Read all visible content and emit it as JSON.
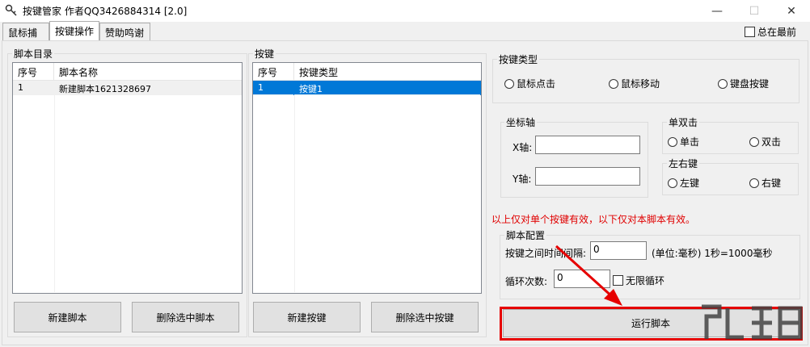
{
  "window": {
    "title": "按键管家 作者QQ3426884314  [2.0]",
    "minimize_glyph": "—",
    "maximize_glyph": "☐",
    "close_glyph": "✕"
  },
  "tabs": [
    "鼠标捕捉",
    "按键操作",
    "赞助鸣谢"
  ],
  "always_on_top_label": "总在最前",
  "script_list": {
    "group_title": "脚本目录",
    "columns": [
      "序号",
      "脚本名称"
    ],
    "rows": [
      [
        "1",
        "新建脚本1621328697"
      ]
    ],
    "new_button": "新建脚本",
    "delete_button": "删除选中脚本"
  },
  "key_list": {
    "group_title": "按键",
    "columns": [
      "序号",
      "按键类型"
    ],
    "rows": [
      [
        "1",
        "按键1"
      ]
    ],
    "new_button": "新建按键",
    "delete_button": "删除选中按键"
  },
  "key_type": {
    "group_title": "按键类型",
    "options": [
      "鼠标点击",
      "鼠标移动",
      "键盘按键"
    ]
  },
  "coords": {
    "group_title": "坐标轴",
    "x_label": "X轴:",
    "y_label": "Y轴:",
    "x_value": "",
    "y_value": ""
  },
  "click_type": {
    "group_title": "单双击",
    "options": [
      "单击",
      "双击"
    ]
  },
  "mouse_button": {
    "group_title": "左右键",
    "options": [
      "左键",
      "右键"
    ]
  },
  "notice": "以上仅对单个按键有效，以下仅对本脚本有效。",
  "script_config": {
    "group_title": "脚本配置",
    "interval_label": "按键之间时间间隔:",
    "interval_value": "0",
    "interval_unit": "(单位:毫秒) 1秒=1000毫秒",
    "loop_label": "循环次数:",
    "loop_value": "0",
    "infinite_label": "无限循环"
  },
  "run_button": "运行脚本",
  "colors": {
    "notice_red": "#e00000",
    "highlight_red": "#e60000",
    "selection_blue": "#0078d7"
  }
}
